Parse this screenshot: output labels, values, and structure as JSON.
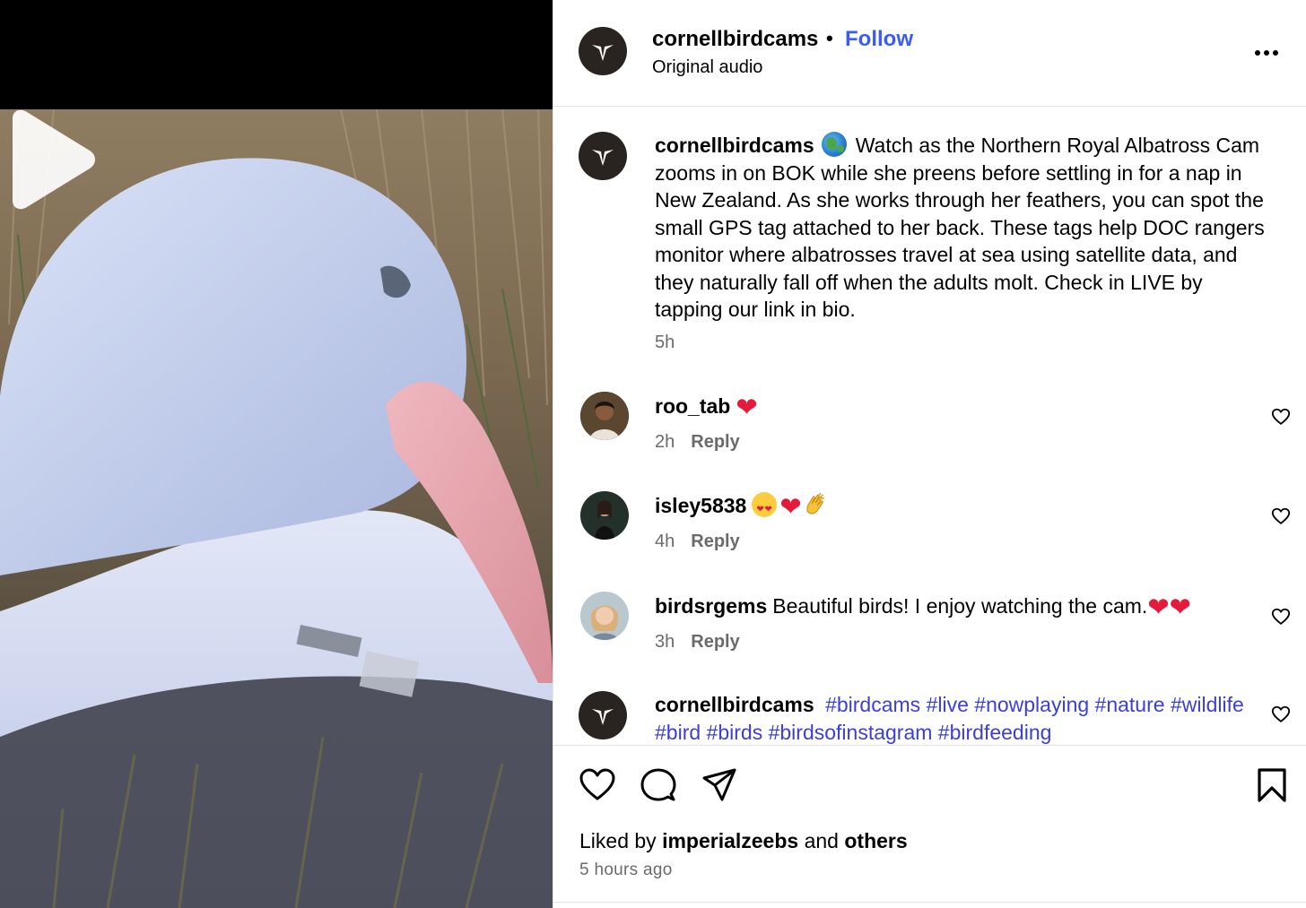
{
  "media": {
    "play_label": "Play"
  },
  "header": {
    "username": "cornellbirdcams",
    "separator": "•",
    "follow_label": "Follow",
    "audio_label": "Original audio"
  },
  "caption": {
    "username": "cornellbirdcams",
    "text": "Watch as the Northern Royal Albatross Cam zooms in on BOK while she preens before settling in for a nap in New Zealand. As she works through her feathers, you can spot the small GPS tag attached to her back. These tags help DOC rangers monitor where albatrosses travel at sea using satellite data, and they naturally fall off when the adults molt. Check in LIVE by tapping our link in bio.",
    "time": "5h"
  },
  "comments": [
    {
      "username": "roo_tab",
      "text": "",
      "time": "2h",
      "reply_label": "Reply"
    },
    {
      "username": "isley5838",
      "text": "",
      "time": "4h",
      "reply_label": "Reply"
    },
    {
      "username": "birdsrgems",
      "text": "Beautiful birds! I enjoy watching the cam.",
      "time": "3h",
      "reply_label": "Reply"
    }
  ],
  "hashtag_comment": {
    "username": "cornellbirdcams",
    "tags": [
      "#birdcams",
      "#live",
      "#nowplaying",
      "#nature",
      "#wildlife",
      "#bird",
      "#birds",
      "#birdsofinstagram",
      "#birdfeeding"
    ]
  },
  "footer": {
    "liked_by_prefix": "Liked by",
    "liked_by_user": "imperialzeebs",
    "liked_by_joiner": "and",
    "liked_by_others": "others",
    "time": "5 hours ago"
  },
  "colors": {
    "follow": "#3b5bf5",
    "hashtag": "#3b3fd6",
    "heart": "#e5193a",
    "muted": "#6b6b6b"
  },
  "icons": [
    "play-icon",
    "more-icon",
    "heart-icon",
    "comment-icon",
    "share-icon",
    "bookmark-icon",
    "globe-emoji",
    "heart-emoji",
    "heart-eyes-emoji",
    "clap-emoji"
  ]
}
